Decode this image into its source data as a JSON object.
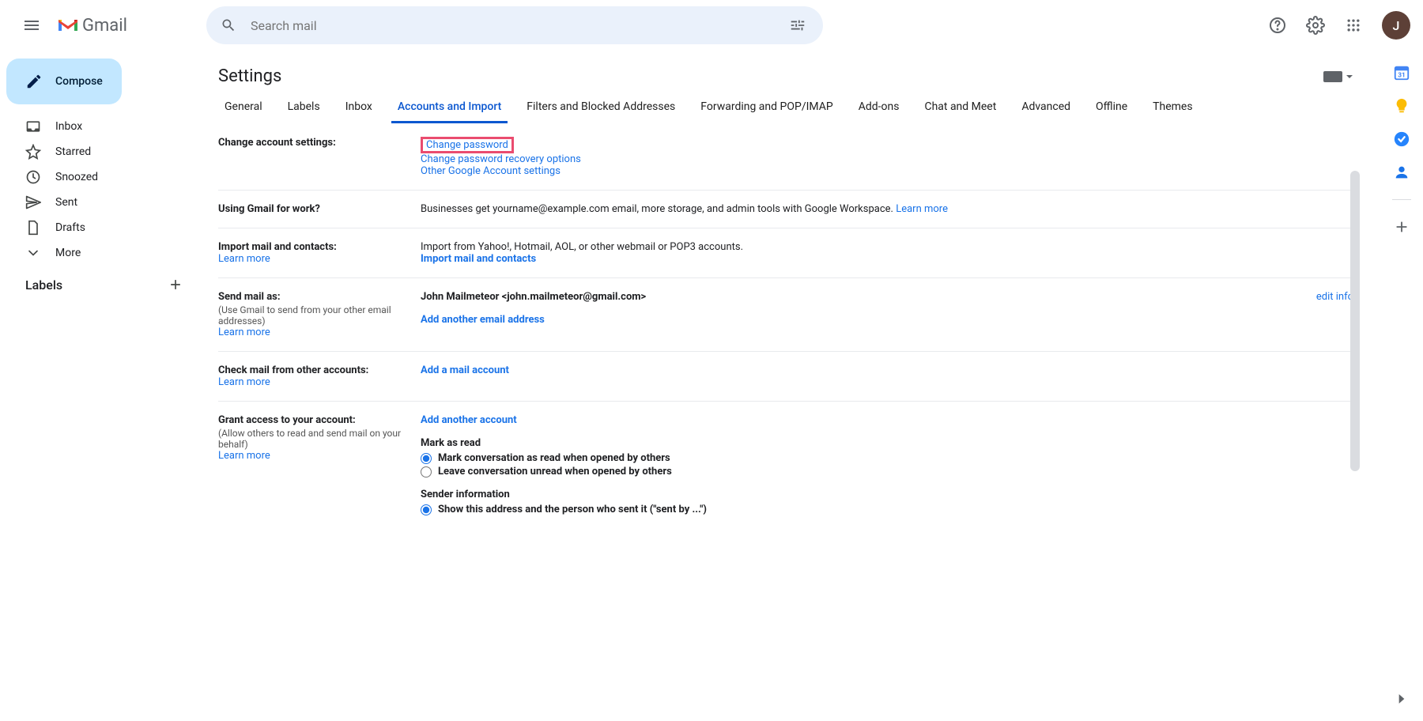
{
  "header": {
    "logo_text": "Gmail",
    "search_placeholder": "Search mail",
    "avatar_initial": "J"
  },
  "sidebar": {
    "compose": "Compose",
    "items": [
      {
        "label": "Inbox",
        "icon": "inbox"
      },
      {
        "label": "Starred",
        "icon": "star"
      },
      {
        "label": "Snoozed",
        "icon": "clock"
      },
      {
        "label": "Sent",
        "icon": "send"
      },
      {
        "label": "Drafts",
        "icon": "file"
      },
      {
        "label": "More",
        "icon": "chevron-down"
      }
    ],
    "labels_header": "Labels"
  },
  "settings": {
    "title": "Settings",
    "tabs": [
      "General",
      "Labels",
      "Inbox",
      "Accounts and Import",
      "Filters and Blocked Addresses",
      "Forwarding and POP/IMAP",
      "Add-ons",
      "Chat and Meet",
      "Advanced",
      "Offline",
      "Themes"
    ],
    "active_tab": "Accounts and Import",
    "sections": {
      "change_account": {
        "label": "Change account settings:",
        "change_password": "Change password",
        "recovery": "Change password recovery options",
        "other": "Other Google Account settings"
      },
      "work": {
        "label": "Using Gmail for work?",
        "text": "Businesses get yourname@example.com email, more storage, and admin tools with Google Workspace. ",
        "learn_more": "Learn more"
      },
      "import": {
        "label": "Import mail and contacts:",
        "learn_more": "Learn more",
        "text": "Import from Yahoo!, Hotmail, AOL, or other webmail or POP3 accounts.",
        "action": "Import mail and contacts"
      },
      "send_as": {
        "label": "Send mail as:",
        "subtext": "(Use Gmail to send from your other email addresses)",
        "learn_more": "Learn more",
        "identity": "John Mailmeteor <john.mailmeteor@gmail.com>",
        "edit_info": "edit info",
        "action": "Add another email address"
      },
      "check_mail": {
        "label": "Check mail from other accounts:",
        "learn_more": "Learn more",
        "action": "Add a mail account"
      },
      "grant": {
        "label": "Grant access to your account:",
        "subtext": "(Allow others to read and send mail on your behalf)",
        "learn_more": "Learn more",
        "action": "Add another account",
        "mark_title": "Mark as read",
        "mark_opt1": "Mark conversation as read when opened by others",
        "mark_opt2": "Leave conversation unread when opened by others",
        "sender_title": "Sender information",
        "sender_opt1": "Show this address and the person who sent it (\"sent by ...\")"
      }
    }
  }
}
